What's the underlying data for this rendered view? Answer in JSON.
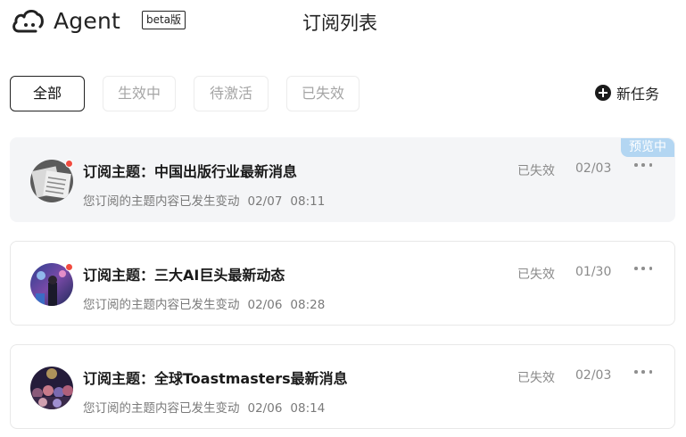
{
  "header": {
    "brand": "Agent",
    "beta": "beta版",
    "title": "订阅列表",
    "logo_icon": "cloud-logo-icon"
  },
  "filters": {
    "items": [
      {
        "label": "全部",
        "active": true
      },
      {
        "label": "生效中",
        "active": false
      },
      {
        "label": "待激活",
        "active": false
      },
      {
        "label": "已失效",
        "active": false
      }
    ],
    "new_task_label": "新任务",
    "new_task_icon": "plus-circle-icon"
  },
  "subscriptions": [
    {
      "title": "订阅主题：中国出版行业最新消息",
      "subtitle": "您订阅的主题内容已发生变动",
      "change_date": "02/07",
      "change_time": "08:11",
      "status": "已失效",
      "date": "02/03",
      "badge": "预览中",
      "unread": true,
      "avatar_icon": "newspaper-avatar"
    },
    {
      "title": "订阅主题：三大AI巨头最新动态",
      "subtitle": "您订阅的主题内容已发生变动",
      "change_date": "02/06",
      "change_time": "08:28",
      "status": "已失效",
      "date": "01/30",
      "badge": "",
      "unread": true,
      "avatar_icon": "ai-avatar"
    },
    {
      "title": "订阅主题：全球Toastmasters最新消息",
      "subtitle": "您订阅的主题内容已发生变动",
      "change_date": "02/06",
      "change_time": "08:14",
      "status": "已失效",
      "date": "02/03",
      "badge": "",
      "unread": false,
      "avatar_icon": "crowd-avatar"
    }
  ],
  "colors": {
    "unread_dot": "#f14b3f",
    "preview_badge": "#b3d6f2",
    "selected_card": "#f4f5f7"
  }
}
